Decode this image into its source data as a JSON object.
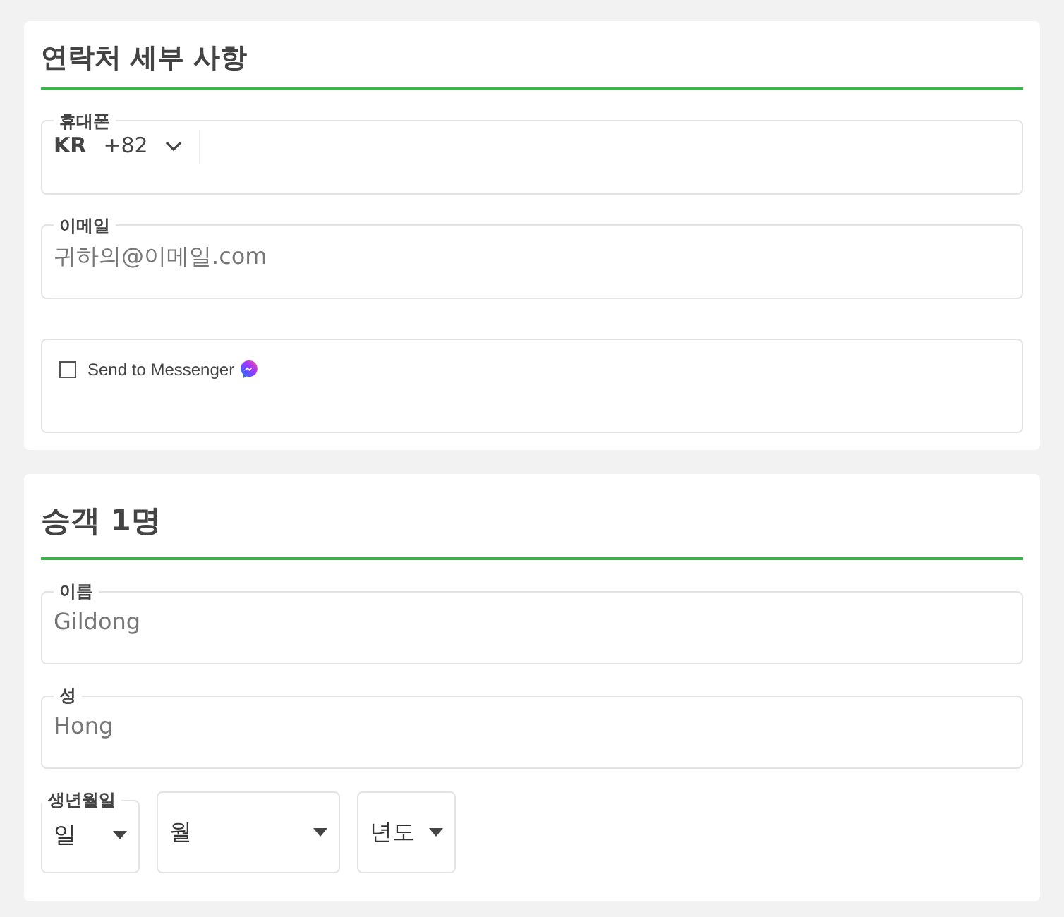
{
  "contact": {
    "title": "연락처 세부 사항",
    "phone": {
      "label": "휴대폰",
      "country": "KR",
      "code": "+82"
    },
    "email": {
      "label": "이메일",
      "placeholder": "귀하의@이메일.com"
    },
    "messenger": {
      "label": "Send to Messenger",
      "checked": false
    }
  },
  "passenger": {
    "title": "승객 1명",
    "first_name": {
      "label": "이름",
      "placeholder": "Gildong"
    },
    "last_name": {
      "label": "성",
      "placeholder": "Hong"
    },
    "birthdate": {
      "label": "생년월일",
      "selects": [
        "일",
        "월",
        "년도"
      ]
    }
  }
}
